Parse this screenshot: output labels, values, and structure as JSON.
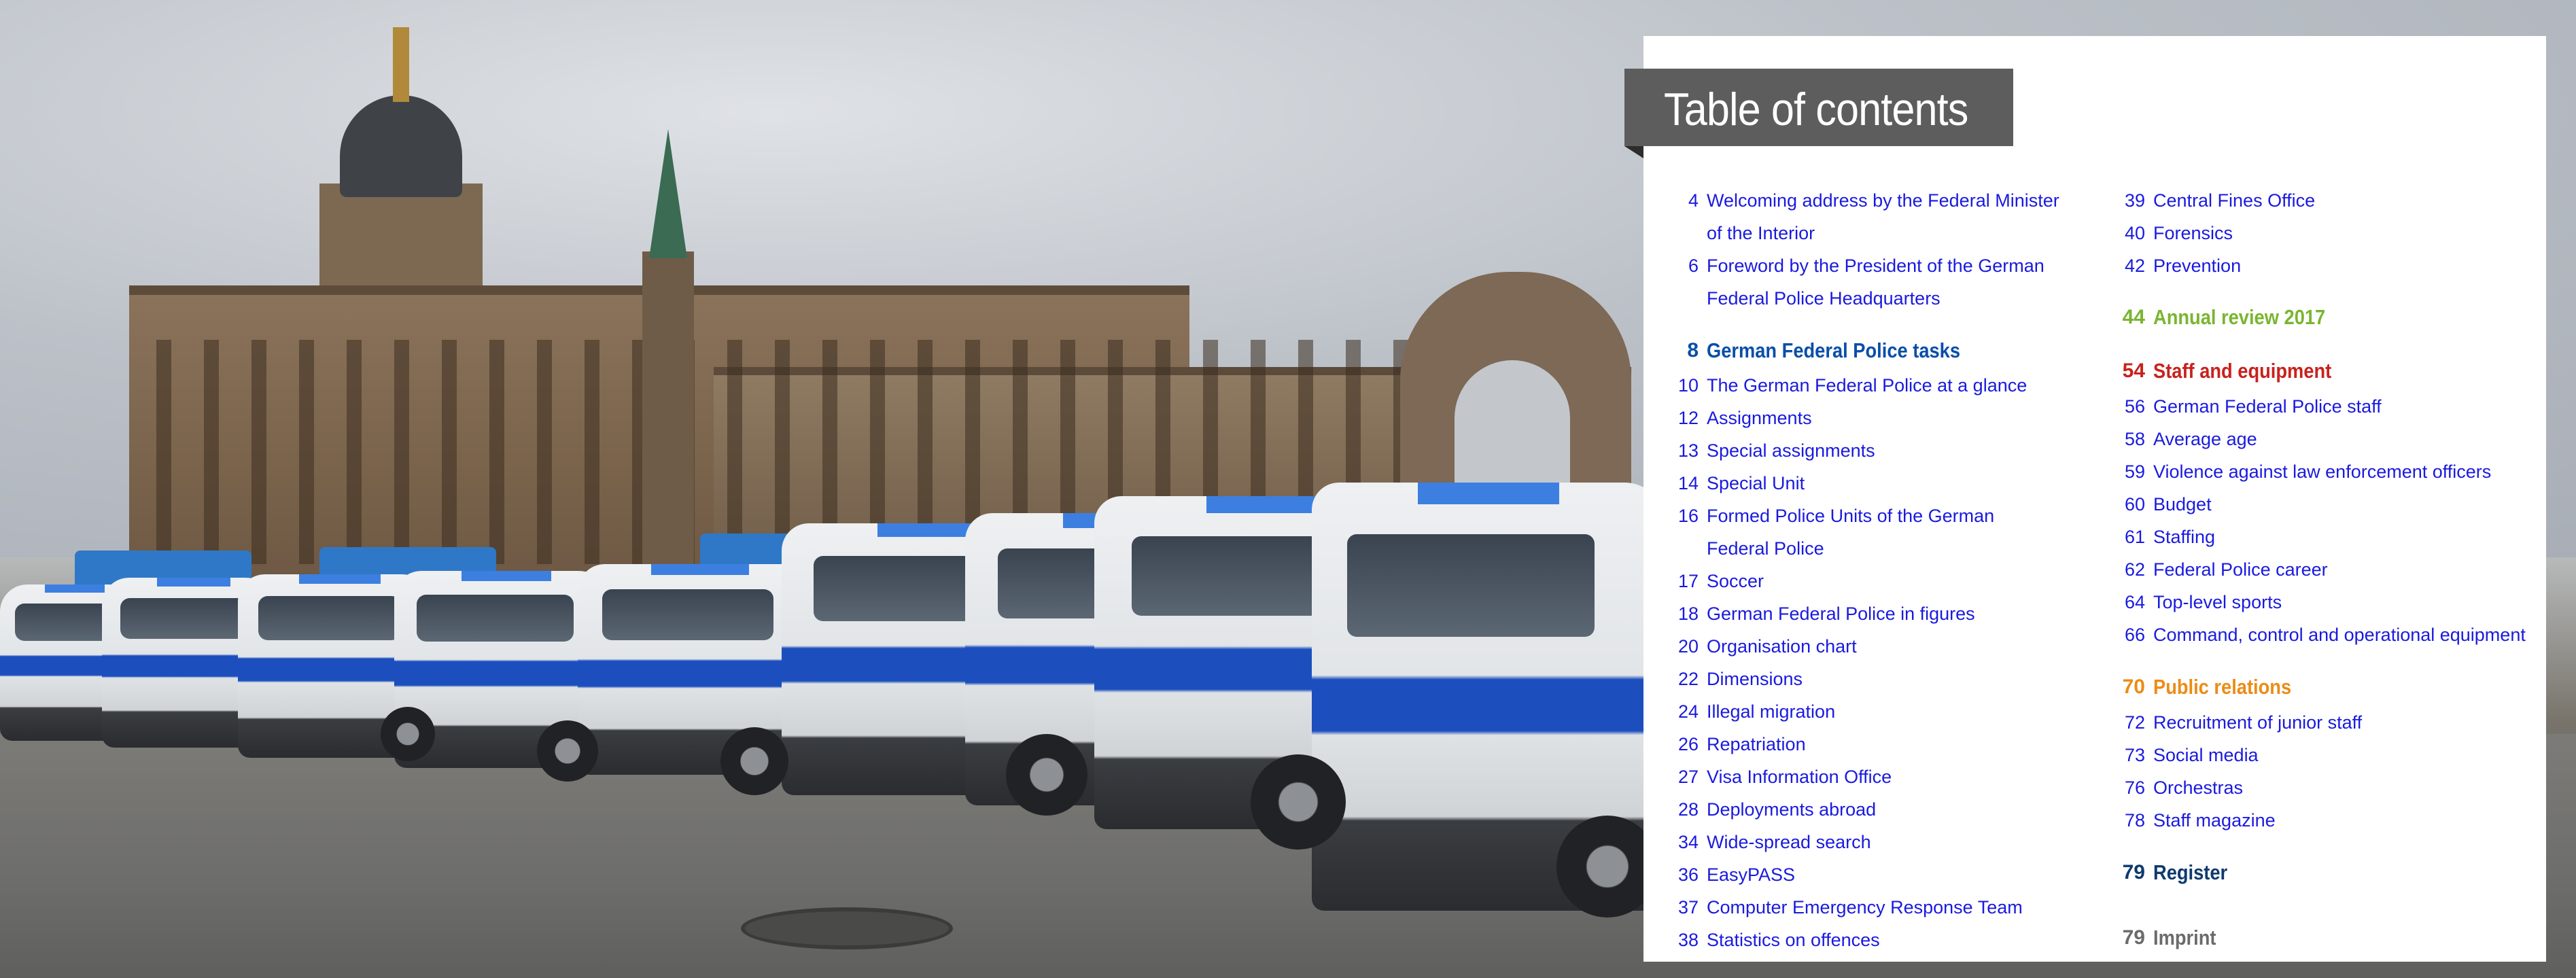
{
  "toc": {
    "title": "Table of contents",
    "left_column": [
      {
        "num": "4",
        "text": "Welcoming address by the Federal Minister",
        "kind": "entry"
      },
      {
        "num": "",
        "text": "of the Interior",
        "kind": "cont"
      },
      {
        "num": "6",
        "text": "Foreword by the President of the German",
        "kind": "entry"
      },
      {
        "num": "",
        "text": "Federal Police Headquarters",
        "kind": "cont"
      },
      {
        "num": "8",
        "text": "German Federal Police tasks",
        "kind": "section",
        "color": "#0a4ea8"
      },
      {
        "num": "10",
        "text": "The German Federal Police at a glance",
        "kind": "entry"
      },
      {
        "num": "12",
        "text": "Assignments",
        "kind": "entry"
      },
      {
        "num": "13",
        "text": "Special assignments",
        "kind": "entry"
      },
      {
        "num": "14",
        "text": "Special Unit",
        "kind": "entry"
      },
      {
        "num": "16",
        "text": "Formed Police Units of the German",
        "kind": "entry"
      },
      {
        "num": "",
        "text": "Federal Police",
        "kind": "cont"
      },
      {
        "num": "17",
        "text": "Soccer",
        "kind": "entry"
      },
      {
        "num": "18",
        "text": "German Federal Police in figures",
        "kind": "entry"
      },
      {
        "num": "20",
        "text": "Organisation chart",
        "kind": "entry"
      },
      {
        "num": "22",
        "text": "Dimensions",
        "kind": "entry"
      },
      {
        "num": "24",
        "text": "Illegal migration",
        "kind": "entry"
      },
      {
        "num": "26",
        "text": "Repatriation",
        "kind": "entry"
      },
      {
        "num": "27",
        "text": "Visa Information Office",
        "kind": "entry"
      },
      {
        "num": "28",
        "text": "Deployments abroad",
        "kind": "entry"
      },
      {
        "num": "34",
        "text": "Wide-spread search",
        "kind": "entry"
      },
      {
        "num": "36",
        "text": "EasyPASS",
        "kind": "entry"
      },
      {
        "num": "37",
        "text": "Computer Emergency Response Team",
        "kind": "entry"
      },
      {
        "num": "38",
        "text": "Statistics on offences",
        "kind": "entry"
      }
    ],
    "right_column": [
      {
        "num": "39",
        "text": "Central Fines Office",
        "kind": "entry"
      },
      {
        "num": "40",
        "text": "Forensics",
        "kind": "entry"
      },
      {
        "num": "42",
        "text": "Prevention",
        "kind": "entry"
      },
      {
        "num": "44",
        "text": "Annual review 2017",
        "kind": "section",
        "color": "#7ab530"
      },
      {
        "num": "54",
        "text": "Staff and equipment",
        "kind": "section",
        "color": "#c8221d"
      },
      {
        "num": "56",
        "text": "German Federal Police staff",
        "kind": "entry"
      },
      {
        "num": "58",
        "text": "Average age",
        "kind": "entry"
      },
      {
        "num": "59",
        "text": "Violence against law enforcement officers",
        "kind": "entry"
      },
      {
        "num": "60",
        "text": "Budget",
        "kind": "entry"
      },
      {
        "num": "61",
        "text": "Staffing",
        "kind": "entry"
      },
      {
        "num": "62",
        "text": "Federal Police career",
        "kind": "entry"
      },
      {
        "num": "64",
        "text": "Top-level sports",
        "kind": "entry"
      },
      {
        "num": "66",
        "text": "Command, control and operational equipment",
        "kind": "entry"
      },
      {
        "num": "70",
        "text": "Public relations",
        "kind": "section",
        "color": "#ec8c16"
      },
      {
        "num": "72",
        "text": "Recruitment of junior staff",
        "kind": "entry"
      },
      {
        "num": "73",
        "text": "Social media",
        "kind": "entry"
      },
      {
        "num": "76",
        "text": "Orchestras",
        "kind": "entry"
      },
      {
        "num": "78",
        "text": "Staff magazine",
        "kind": "entry"
      },
      {
        "num": "79",
        "text": "Register",
        "kind": "section",
        "color": "#0e3a6e"
      },
      {
        "num": "79",
        "text": "Imprint",
        "kind": "section",
        "color": "#6b6b6b"
      }
    ],
    "entry_color": "#1a1adf"
  }
}
